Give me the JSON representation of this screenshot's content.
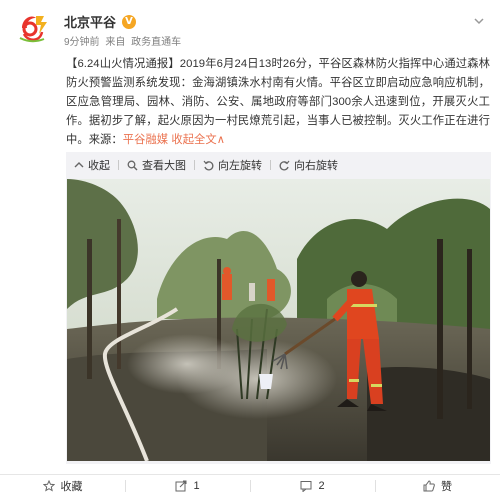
{
  "post": {
    "author": "北京平谷",
    "verified_badge": "V",
    "time": "9分钟前",
    "source_prefix": "来自",
    "source": "政务直通车",
    "text_hashtag": "【6.24山火情况通报】",
    "text_body": "2019年6月24日13时26分，平谷区森林防火指挥中心通过森林防火预警监测系统发现：金海湖镇洙水村南有火情。平谷区立即启动应急响应机制，区应急管理局、园林、消防、公安、属地政府等部门300余人迅速到位，开展灭火工作。据初步了解，起火原因为一村民燎荒引起，当事人已被控制。灭火工作正在进行中。来源：",
    "text_source_link": "平谷融媒",
    "text_more": "收起全文",
    "text_more_arrow": "∧"
  },
  "image_toolbar": {
    "collapse": "收起",
    "view_large": "查看大图",
    "rotate_left": "向左旋转",
    "rotate_right": "向右旋转"
  },
  "actions": {
    "favorite": "收藏",
    "repost_count": "1",
    "comment_count": "2",
    "like": "赞"
  },
  "colors": {
    "accent": "#eb7350",
    "text": "#333333",
    "meta": "#808080",
    "panel": "#f2f2f5"
  }
}
